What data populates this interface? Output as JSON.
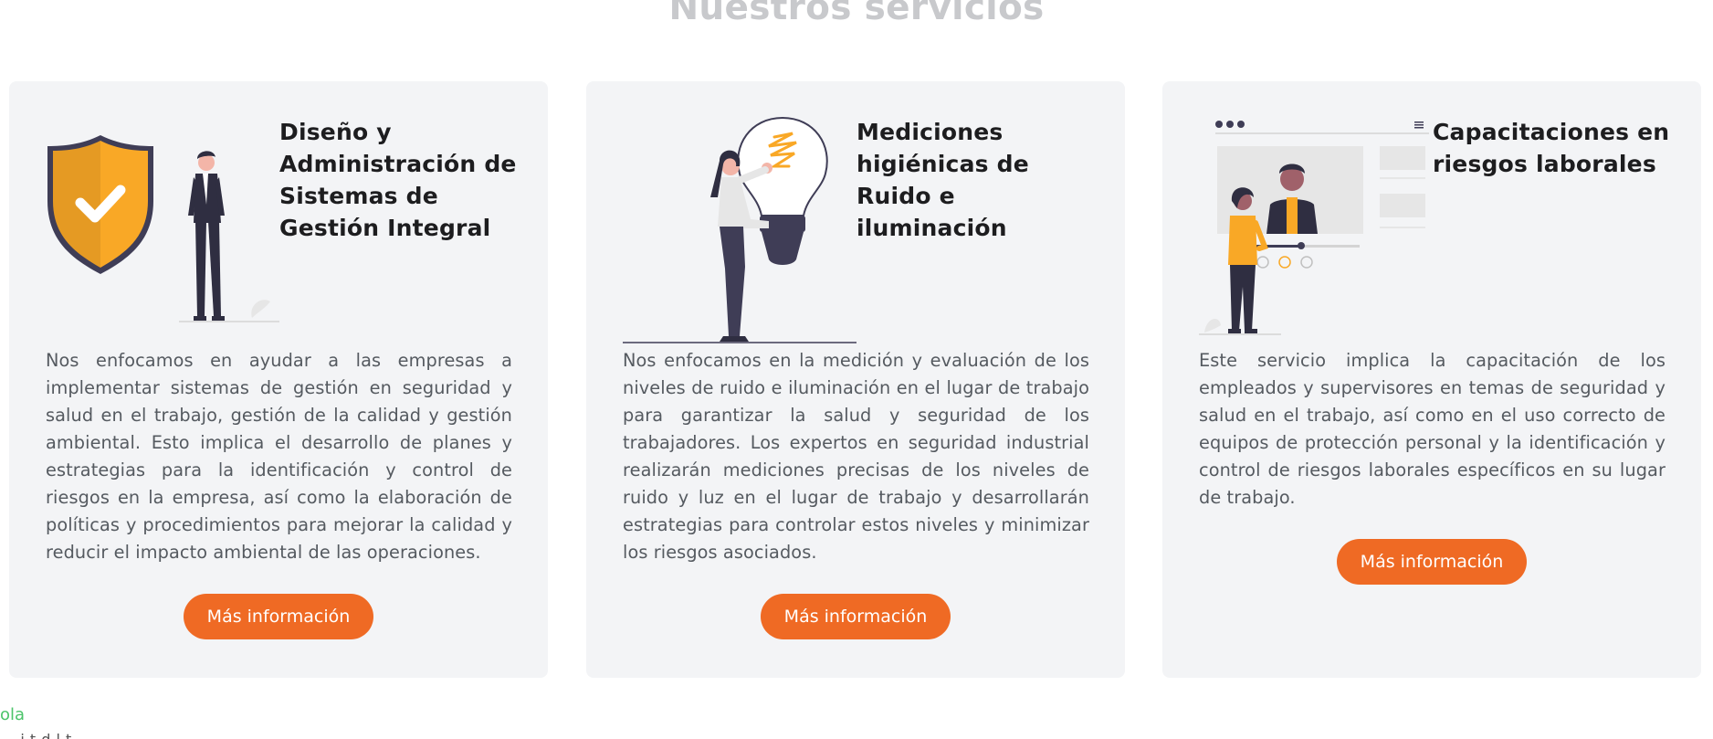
{
  "section": {
    "title": "Nuestros servicios"
  },
  "cards": [
    {
      "title": "Diseño y Administración de Sistemas de Gestión Integral",
      "description": "Nos enfocamos en ayudar a las empresas a implementar sistemas de gestión en seguridad y salud en el trabajo, gestión de la calidad y gestión ambiental. Esto implica el desarrollo de planes y estrategias para la identificación y control de riesgos en la empresa, así como la elaboración de políticas y procedimientos para mejorar la calidad y reducir el impacto ambiental de las operaciones.",
      "button_label": "Más información",
      "illustration": "shield-person-illustration"
    },
    {
      "title": "Mediciones higiénicas de Ruido e iluminación",
      "description": "Nos enfocamos en la medición y evaluación de los niveles de ruido e iluminación en el lugar de trabajo para garantizar la salud y seguridad de los trabajadores. Los expertos en seguridad industrial realizarán mediciones precisas de los niveles de ruido y luz en el lugar de trabajo y desarrollarán estrategias para controlar estos niveles y minimizar los riesgos asociados.",
      "button_label": "Más información",
      "illustration": "lightbulb-person-illustration"
    },
    {
      "title": "Capacitaciones en riesgos laborales",
      "description": "Este servicio implica la capacitación de los empleados y supervisores en temas de seguridad y salud en el trabajo, así como en el uso correcto de equipos de protección personal y la identificación y control de riesgos laborales específicos en su lugar de trabajo.",
      "button_label": "Más información",
      "illustration": "video-call-illustration"
    }
  ],
  "footer": {
    "link_text": "ola",
    "partial_text": "... i t d l t"
  },
  "colors": {
    "accent": "#ef6a24",
    "card_background": "#f3f4f6",
    "title_muted": "#c8c9cc",
    "illustration_yellow": "#f9a826",
    "link_green": "#4cc46a"
  }
}
